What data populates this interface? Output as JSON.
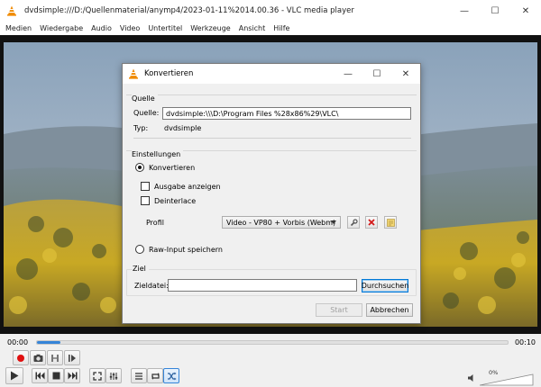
{
  "window": {
    "title": "dvdsimple:///D:/Quellenmaterial/anymp4/2023-01-11%2014.00.36 - VLC media player",
    "minimize": "—",
    "maximize": "☐",
    "close": "✕"
  },
  "menu": [
    "Medien",
    "Wiedergabe",
    "Audio",
    "Video",
    "Untertitel",
    "Werkzeuge",
    "Ansicht",
    "Hilfe"
  ],
  "player": {
    "time_elapsed": "00:00",
    "time_total": "00:10",
    "progress_fraction": 0.05,
    "volume_label": "0%",
    "accent": "#3584d8"
  },
  "dialog": {
    "title": "Konvertieren",
    "source": {
      "group_label": "Quelle",
      "source_label": "Quelle:",
      "source_value": "dvdsimple:\\\\\\D:\\Program Files %28x86%29\\VLC\\",
      "type_label": "Typ:",
      "type_value": "dvdsimple"
    },
    "settings": {
      "group_label": "Einstellungen",
      "convert_label": "Konvertieren",
      "show_output_label": "Ausgabe anzeigen",
      "deinterlace_label": "Deinterlace",
      "profile_label": "Profil",
      "profile_value": "Video - VP80 + Vorbis (Webm)",
      "raw_input_label": "Raw-Input speichern"
    },
    "target": {
      "group_label": "Ziel",
      "file_label": "Zieldatei:",
      "file_value": "",
      "browse_label": "Durchsuchen"
    },
    "start_label": "Start",
    "cancel_label": "Abbrechen"
  },
  "icons": {
    "app": "vlc-cone-icon",
    "record": "record-icon",
    "snapshot": "camera-icon",
    "loop_ab": "loop-ab-icon",
    "frame_step": "frame-step-icon",
    "play": "play-icon",
    "prev": "previous-icon",
    "stop": "stop-icon",
    "next": "next-icon",
    "fullscreen": "fullscreen-icon",
    "extended": "equalizer-icon",
    "playlist": "playlist-icon",
    "loop": "loop-icon",
    "shuffle": "shuffle-icon",
    "volume": "speaker-icon"
  }
}
